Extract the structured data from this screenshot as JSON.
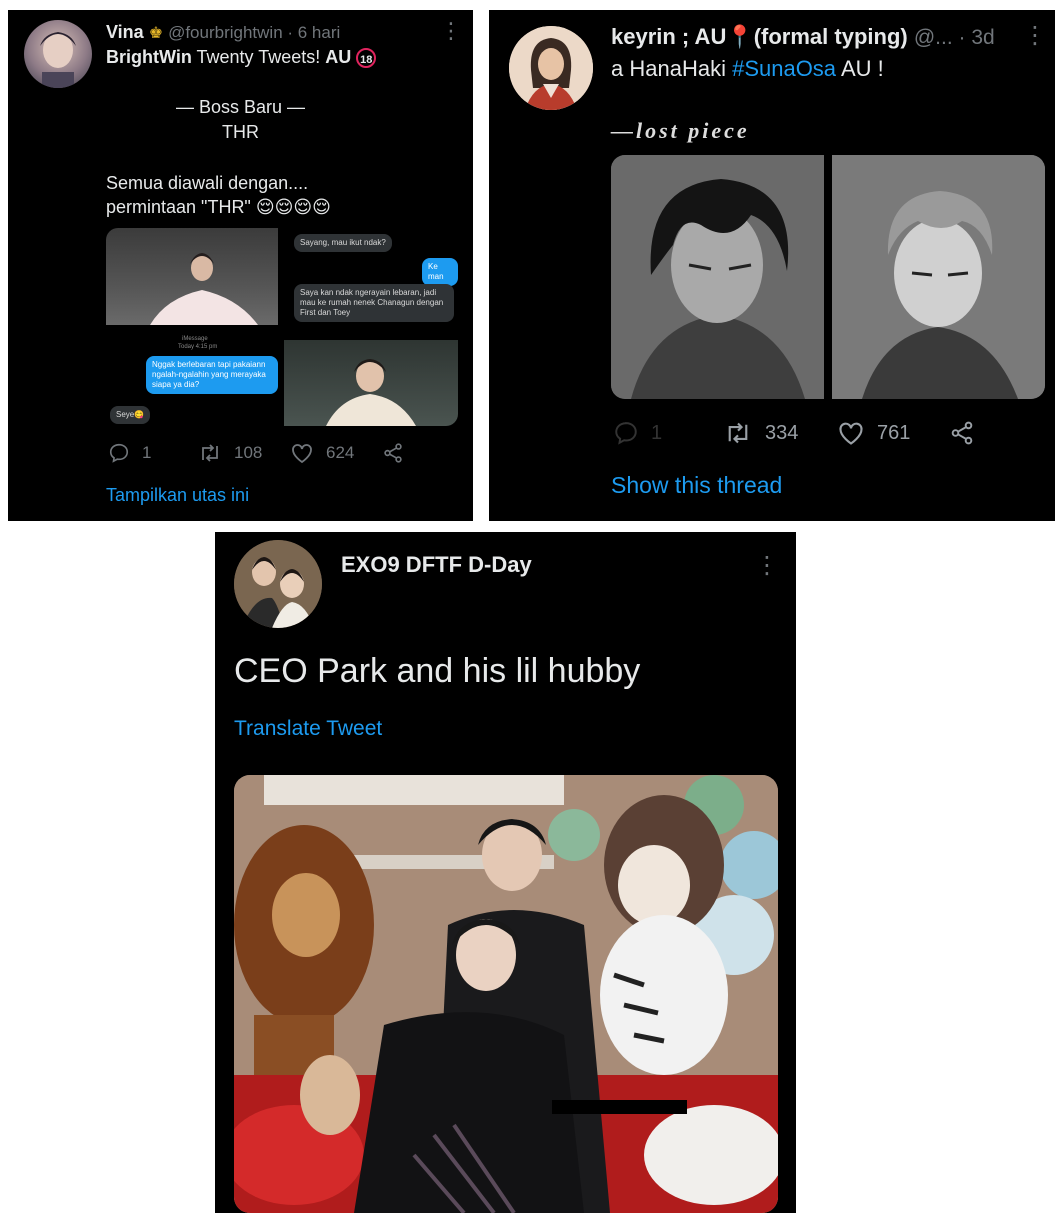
{
  "tweet1": {
    "user_name": "Vina",
    "handle_time": "@fourbrightwin · 6 hari",
    "title_bold": "BrightWin",
    "title_rest": " Twenty Tweets! ",
    "title_au": "AU",
    "age_badge": "18",
    "body_line1": "— Boss Baru —",
    "body_line2": "THR",
    "body_line3": "Semua diawali dengan....",
    "body_line4": "permintaan \"THR\" 😌😌😌😌",
    "chat": {
      "msg1": "Sayang, mau ikut ndak?",
      "msg2": "Ke man",
      "msg3": "Saya kan ndak ngerayain lebaran, jadi mau ke rumah nenek Chanagun dengan First dan Toey",
      "label1": "iMessage",
      "label2": "Today 4:15 pm",
      "msg4": "Nggak berlebaran tapi pakaiann ngalah-ngalahin yang merayaka siapa ya dia?",
      "msg5": "Seye😋"
    },
    "replies": "1",
    "retweets": "108",
    "likes": "624",
    "thread_link": "Tampilkan utas ini"
  },
  "tweet2": {
    "user_name": "keyrin ; AU📍(formal typing)",
    "handle_time": "@... · 3d",
    "body_pre": "a HanaHaki ",
    "hashtag": "#SunaOsa",
    "body_post": " AU !",
    "image_caption": "—lost piece",
    "replies": "1",
    "retweets": "334",
    "likes": "761",
    "thread_link": "Show this thread"
  },
  "tweet3": {
    "user_name": "EXO9 DFTF D-Day",
    "body": "CEO Park and his lil hubby",
    "translate": "Translate Tweet"
  },
  "colors": {
    "background": "#000000",
    "text": "#e7e9ea",
    "muted": "#71767b",
    "accent": "#1d9bf0"
  }
}
